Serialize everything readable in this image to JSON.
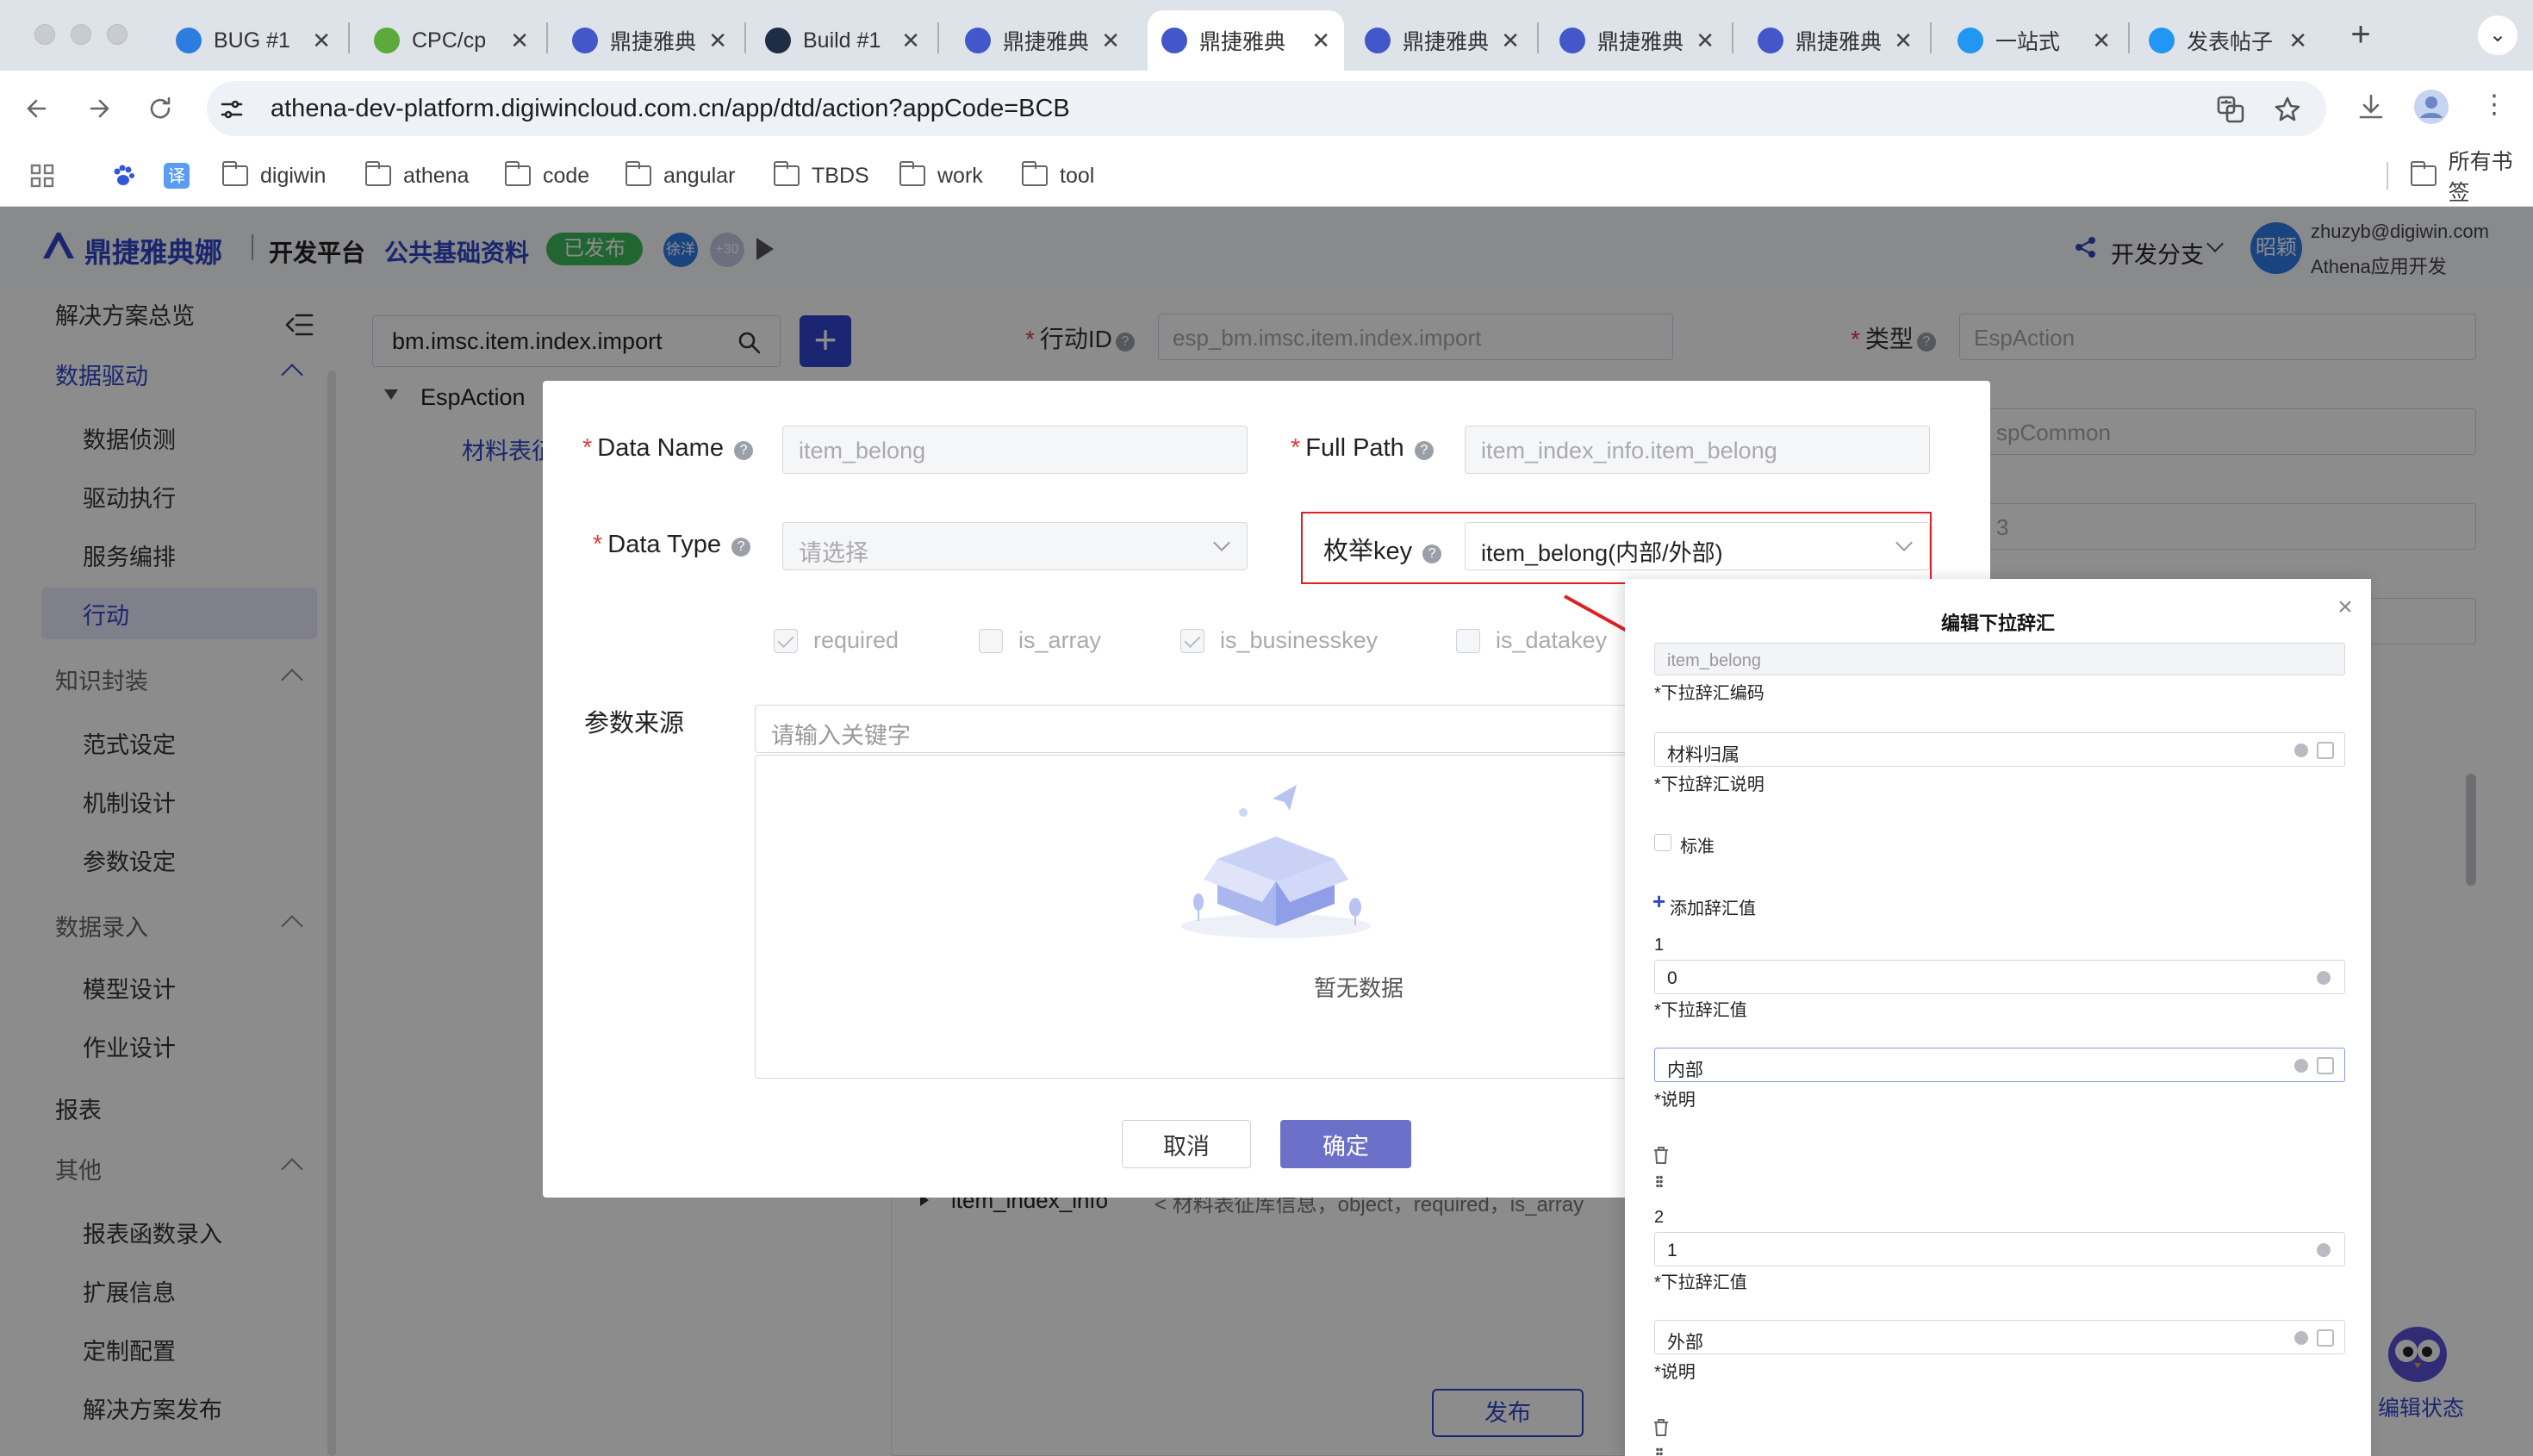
{
  "browser": {
    "tabs": [
      {
        "title": "BUG #1",
        "favicon_color": "#2d7de0"
      },
      {
        "title": "CPC/cp",
        "favicon_color": "#5caa3c"
      },
      {
        "title": "鼎捷雅典",
        "favicon_color": "#4257c9"
      },
      {
        "title": "Build #1",
        "favicon_color": "#1f2d44"
      },
      {
        "title": "鼎捷雅典",
        "favicon_color": "#4257c9"
      },
      {
        "title": "鼎捷雅典",
        "favicon_color": "#4257c9"
      },
      {
        "title": "鼎捷雅典",
        "favicon_color": "#4257c9"
      },
      {
        "title": "鼎捷雅典",
        "favicon_color": "#4257c9"
      },
      {
        "title": "鼎捷雅典",
        "favicon_color": "#4257c9"
      },
      {
        "title": "一站式",
        "favicon_color": "#2196f3"
      },
      {
        "title": "发表帖子",
        "favicon_color": "#2196f3"
      }
    ],
    "active_tab_index": 5,
    "url": "athena-dev-platform.digiwincloud.com.cn/app/dtd/action?appCode=BCB",
    "bookmarks": [
      "digiwin",
      "athena",
      "code",
      "angular",
      "TBDS",
      "work",
      "tool"
    ],
    "bookmark_apps": [
      "apps-icon",
      "baidu-icon",
      "translate-icon"
    ],
    "all_bookmarks": "所有书签"
  },
  "app": {
    "logo": "鼎捷雅典娜",
    "platform": "开发平台",
    "project": "公共基础资料",
    "status_badge": "已发布",
    "avatar_text": "徐洋",
    "avatar_more": "+30",
    "branch": "开发分支",
    "user_avatar": "昭颖",
    "user_email": "zhuzyb@digiwin.com",
    "user_role": "Athena应用开发",
    "sidebar": [
      {
        "label": "解决方案总览",
        "type": "top"
      },
      {
        "label": "数据驱动",
        "type": "group-open"
      },
      {
        "label": "数据侦测",
        "type": "sub"
      },
      {
        "label": "驱动执行",
        "type": "sub"
      },
      {
        "label": "服务编排",
        "type": "sub"
      },
      {
        "label": "行动",
        "type": "sub-selected"
      },
      {
        "label": "知识封装",
        "type": "group"
      },
      {
        "label": "范式设定",
        "type": "sub"
      },
      {
        "label": "机制设计",
        "type": "sub"
      },
      {
        "label": "参数设定",
        "type": "sub"
      },
      {
        "label": "数据录入",
        "type": "group"
      },
      {
        "label": "模型设计",
        "type": "sub"
      },
      {
        "label": "作业设计",
        "type": "sub"
      },
      {
        "label": "报表",
        "type": "top"
      },
      {
        "label": "其他",
        "type": "group"
      },
      {
        "label": "报表函数录入",
        "type": "sub"
      },
      {
        "label": "扩展信息",
        "type": "sub"
      },
      {
        "label": "定制配置",
        "type": "sub"
      },
      {
        "label": "解决方案发布",
        "type": "sub"
      }
    ],
    "search_value": "bm.imsc.item.index.import",
    "tree_root": "EspAction",
    "tree_child": "材料表征",
    "action_id_label": "行动ID",
    "action_id_value": "esp_bm.imsc.item.index.import",
    "type_label": "类型",
    "type_value": "EspAction",
    "espcommon_value": "spCommon",
    "field_b": "3",
    "tree_item": "item_index_info",
    "tree_item_desc": "< 材料表征库信息，object，required，is_array",
    "publish_button": "发布",
    "edit_state": "编辑状态"
  },
  "modal": {
    "data_name_label": "Data Name",
    "data_name_value": "item_belong",
    "full_path_label": "Full Path",
    "full_path_value": "item_index_info.item_belong",
    "data_type_label": "Data Type",
    "data_type_placeholder": "请选择",
    "enum_key_label": "枚举key",
    "enum_key_value": "item_belong(内部/外部)",
    "checkboxes": [
      {
        "label": "required",
        "checked": true
      },
      {
        "label": "is_array",
        "checked": false
      },
      {
        "label": "is_businesskey",
        "checked": true
      },
      {
        "label": "is_datakey",
        "checked": false
      }
    ],
    "param_source_label": "参数来源",
    "param_search_placeholder": "请输入关键字",
    "empty_text": "暂无数据",
    "cancel": "取消",
    "confirm": "确定",
    "highlight_color": "#e02020"
  },
  "drawer": {
    "title": "编辑下拉辞汇",
    "code_value": "item_belong",
    "code_label": "*下拉辞汇编码",
    "desc_value": "材料归属",
    "desc_label": "*下拉辞汇说明",
    "standard_label": "标准",
    "add_value_label": "添加辞汇值",
    "values": [
      {
        "index": "1",
        "value": "0",
        "value_label": "*下拉辞汇值",
        "desc": "内部",
        "desc_label": "*说明"
      },
      {
        "index": "2",
        "value": "1",
        "value_label": "*下拉辞汇值",
        "desc": "外部",
        "desc_label": "*说明"
      }
    ]
  }
}
